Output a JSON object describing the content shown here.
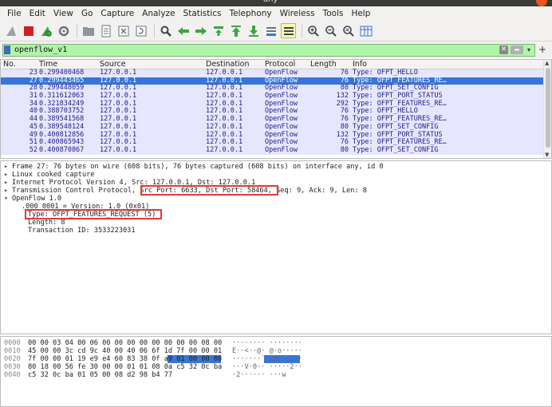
{
  "window": {
    "title": "any"
  },
  "menu": [
    {
      "label": "File"
    },
    {
      "label": "Edit"
    },
    {
      "label": "View"
    },
    {
      "label": "Go"
    },
    {
      "label": "Capture"
    },
    {
      "label": "Analyze"
    },
    {
      "label": "Statistics"
    },
    {
      "label": "Telephony"
    },
    {
      "label": "Wireless"
    },
    {
      "label": "Tools"
    },
    {
      "label": "Help"
    }
  ],
  "filter": {
    "value": "openflow_v1"
  },
  "columns": {
    "no": "No.",
    "time": "Time",
    "source": "Source",
    "destination": "Destination",
    "protocol": "Protocol",
    "length": "Length",
    "info": "Info"
  },
  "packets": [
    {
      "no": "23",
      "time": "0.299400468",
      "src": "127.0.0.1",
      "dst": "127.0.0.1",
      "proto": "OpenFlow",
      "len": "76",
      "info": "Type: OFPT_HELLO"
    },
    {
      "no": "27",
      "time": "0.299443465",
      "src": "127.0.0.1",
      "dst": "127.0.0.1",
      "proto": "OpenFlow",
      "len": "76",
      "info": "Type: OFPT_FEATURES_RE…"
    },
    {
      "no": "28",
      "time": "0.299448059",
      "src": "127.0.0.1",
      "dst": "127.0.0.1",
      "proto": "OpenFlow",
      "len": "80",
      "info": "Type: OFPT_SET_CONFIG"
    },
    {
      "no": "31",
      "time": "0.311612063",
      "src": "127.0.0.1",
      "dst": "127.0.0.1",
      "proto": "OpenFlow",
      "len": "132",
      "info": "Type: OFPT_PORT_STATUS"
    },
    {
      "no": "34",
      "time": "0.321834249",
      "src": "127.0.0.1",
      "dst": "127.0.0.1",
      "proto": "OpenFlow",
      "len": "292",
      "info": "Type: OFPT_FEATURES_RE…"
    },
    {
      "no": "40",
      "time": "0.388703752",
      "src": "127.0.0.1",
      "dst": "127.0.0.1",
      "proto": "OpenFlow",
      "len": "76",
      "info": "Type: OFPT_HELLO"
    },
    {
      "no": "44",
      "time": "0.389541568",
      "src": "127.0.0.1",
      "dst": "127.0.0.1",
      "proto": "OpenFlow",
      "len": "76",
      "info": "Type: OFPT_FEATURES_RE…"
    },
    {
      "no": "45",
      "time": "0.389548124",
      "src": "127.0.0.1",
      "dst": "127.0.0.1",
      "proto": "OpenFlow",
      "len": "80",
      "info": "Type: OFPT_SET_CONFIG"
    },
    {
      "no": "49",
      "time": "0.400812856",
      "src": "127.0.0.1",
      "dst": "127.0.0.1",
      "proto": "OpenFlow",
      "len": "132",
      "info": "Type: OFPT_PORT_STATUS"
    },
    {
      "no": "51",
      "time": "0.400865943",
      "src": "127.0.0.1",
      "dst": "127.0.0.1",
      "proto": "OpenFlow",
      "len": "76",
      "info": "Type: OFPT_FEATURES_RE…"
    },
    {
      "no": "52",
      "time": "0.400870867",
      "src": "127.0.0.1",
      "dst": "127.0.0.1",
      "proto": "OpenFlow",
      "len": "80",
      "info": "Type: OFPT_SET_CONFIG"
    }
  ],
  "details": [
    {
      "arrow": "▸",
      "text": "Frame 27: 76 bytes on wire (608 bits), 76 bytes captured (608 bits) on interface any, id 0"
    },
    {
      "arrow": "▸",
      "text": "Linux cooked capture"
    },
    {
      "arrow": "▸",
      "text": "Internet Protocol Version 4, Src: 127.0.0.1, Dst: 127.0.0.1"
    },
    {
      "arrow": "▸",
      "text": "Transmission Control Protocol, Src Port: 6633, Dst Port: 58464, Seq: 9, Ack: 9, Len: 8"
    },
    {
      "arrow": "▾",
      "text": "OpenFlow 1.0"
    },
    {
      "arrow": "",
      "text": "   .000 0001 = Version: 1.0 (0x01)"
    },
    {
      "arrow": "",
      "text": "Type: OFPT_FEATURES_REQUEST (5)"
    },
    {
      "arrow": "",
      "text": "Length: 8"
    },
    {
      "arrow": "",
      "text": "Transaction ID: 3533223031"
    }
  ],
  "bytes": [
    {
      "off": "0000",
      "hex": "00 00 03 04 00 06 00 00  00 00 00 00 00 00 08 00",
      "ascii": "········ ········"
    },
    {
      "off": "0010",
      "hex": "45 00 00 3c cd 9c 40 00  40 06 6f 1d 7f 00 00 01",
      "ascii": "E··<··@· @·o·····"
    },
    {
      "off": "0020",
      "hex": "7f 00 00 01 19 e9 e4 60  83 38 0f a9 01 00 00 08",
      "ascii": "·······` ·8······"
    },
    {
      "off": "0030",
      "hex": "80 18 00 56 fe 30 00 00  01 01 08 0a c5 32 0c ba",
      "ascii": "···V·0·· ·····2··"
    },
    {
      "off": "0040",
      "hex": "c5 32 0c ba 01 05 00 08  d2 98 b4 77",
      "ascii": "·2······ ···w"
    }
  ],
  "colors": {
    "selected_row": "#3875d7",
    "row_bg": "#e7e6ff",
    "row_text": "#1c1f87",
    "filter_bg": "#aff5a8",
    "highlight": "#e03a3a"
  }
}
